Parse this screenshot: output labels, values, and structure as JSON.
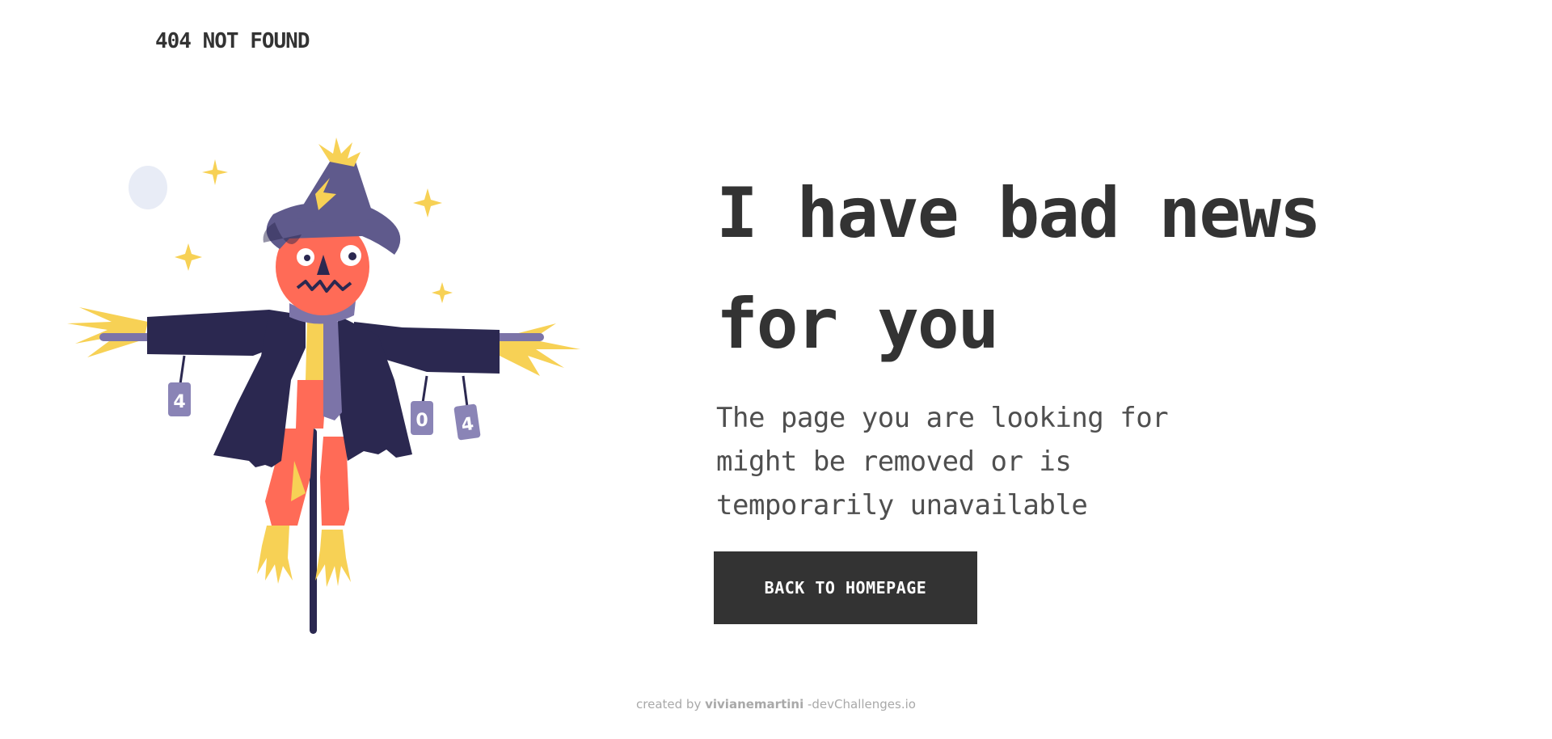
{
  "header": {
    "logo_text": "404 NOT FOUND"
  },
  "illustration": {
    "can_labels": [
      "4",
      "0",
      "4"
    ],
    "colors": {
      "coat": "#2b2850",
      "hat": "#5f5a8c",
      "face": "#ff6b57",
      "straw": "#f7d155",
      "scarf": "#7c74a8",
      "moon": "#e8ecf6",
      "sparkle": "#f7d155",
      "can": "#8a84b6"
    }
  },
  "main": {
    "headline": "I have bad news for you",
    "description": "The page you are looking for might be removed or is temporarily unavailable",
    "button_label": "BACK TO HOMEPAGE"
  },
  "footer": {
    "prefix": "created by ",
    "author": "vivianemartini",
    "suffix": " -devChallenges.io"
  },
  "colors": {
    "text_primary": "#333333",
    "button_bg": "#333333",
    "button_text": "#ffffff",
    "footer_text": "#a9a9a9"
  }
}
